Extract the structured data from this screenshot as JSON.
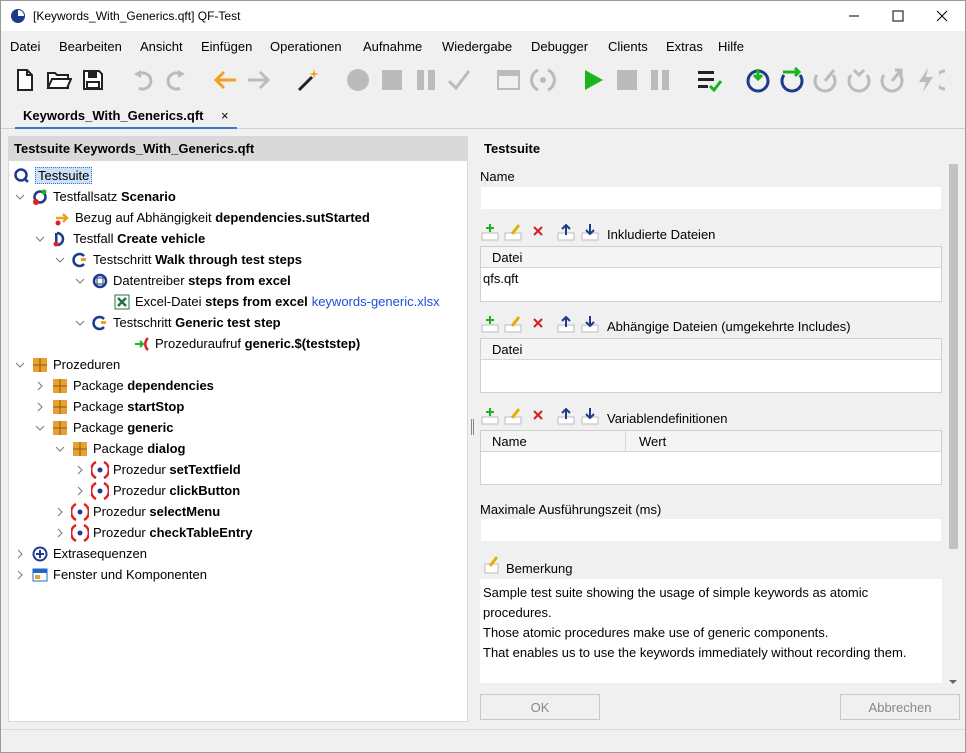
{
  "window": {
    "title": "[Keywords_With_Generics.qft] QF-Test"
  },
  "menu": [
    "Datei",
    "Bearbeiten",
    "Ansicht",
    "Einfügen",
    "Operationen",
    "Aufnahme",
    "Wiedergabe",
    "Debugger",
    "Clients",
    "Extras",
    "Hilfe"
  ],
  "tab": {
    "label": "Keywords_With_Generics.qft",
    "close": "×"
  },
  "tree": {
    "header": "Testsuite Keywords_With_Generics.qft",
    "root": "Testsuite",
    "items": [
      {
        "prefix": "Testfallsatz",
        "name": "Scenario"
      },
      {
        "prefix": "Bezug auf Abhängigkeit",
        "name": "dependencies.sutStarted"
      },
      {
        "prefix": "Testfall",
        "name": "Create vehicle"
      },
      {
        "prefix": "Testschritt",
        "name": "Walk through test steps"
      },
      {
        "prefix": "Datentreiber",
        "name": "steps from excel"
      },
      {
        "prefix": "Excel-Datei",
        "name": "steps from excel",
        "link": "keywords-generic.xlsx"
      },
      {
        "prefix": "Testschritt",
        "name": "Generic test step"
      },
      {
        "prefix": "Prozeduraufruf",
        "name": "generic.$(teststep)"
      },
      {
        "prefix": "Prozeduren",
        "name": ""
      },
      {
        "prefix": "Package",
        "name": "dependencies"
      },
      {
        "prefix": "Package",
        "name": "startStop"
      },
      {
        "prefix": "Package",
        "name": "generic"
      },
      {
        "prefix": "Package",
        "name": "dialog"
      },
      {
        "prefix": "Prozedur",
        "name": "setTextfield"
      },
      {
        "prefix": "Prozedur",
        "name": "clickButton"
      },
      {
        "prefix": "Prozedur",
        "name": "selectMenu"
      },
      {
        "prefix": "Prozedur",
        "name": "checkTableEntry"
      },
      {
        "prefix": "Extrasequenzen",
        "name": ""
      },
      {
        "prefix": "Fenster und Komponenten",
        "name": ""
      }
    ]
  },
  "detail": {
    "title": "Testsuite",
    "name_label": "Name",
    "name_value": "",
    "included": {
      "label": "Inkludierte Dateien",
      "col": "Datei",
      "rows": [
        "qfs.qft"
      ]
    },
    "dependent": {
      "label": "Abhängige Dateien (umgekehrte Includes)",
      "col": "Datei",
      "rows": []
    },
    "vars": {
      "label": "Variablendefinitionen",
      "col_name": "Name",
      "col_value": "Wert"
    },
    "timeout_label": "Maximale Ausführungszeit (ms)",
    "remark_label": "Bemerkung",
    "remark_lines": [
      "Sample test suite showing the usage of simple keywords as atomic",
      "procedures.",
      "Those atomic procedures make use of generic components.",
      "That enables us to use the keywords immediately without recording them."
    ],
    "ok": "OK",
    "cancel": "Abbrechen"
  },
  "colors": {
    "accent": "#3c78c8",
    "play": "#1db31d",
    "arrow": "#f0a020"
  }
}
